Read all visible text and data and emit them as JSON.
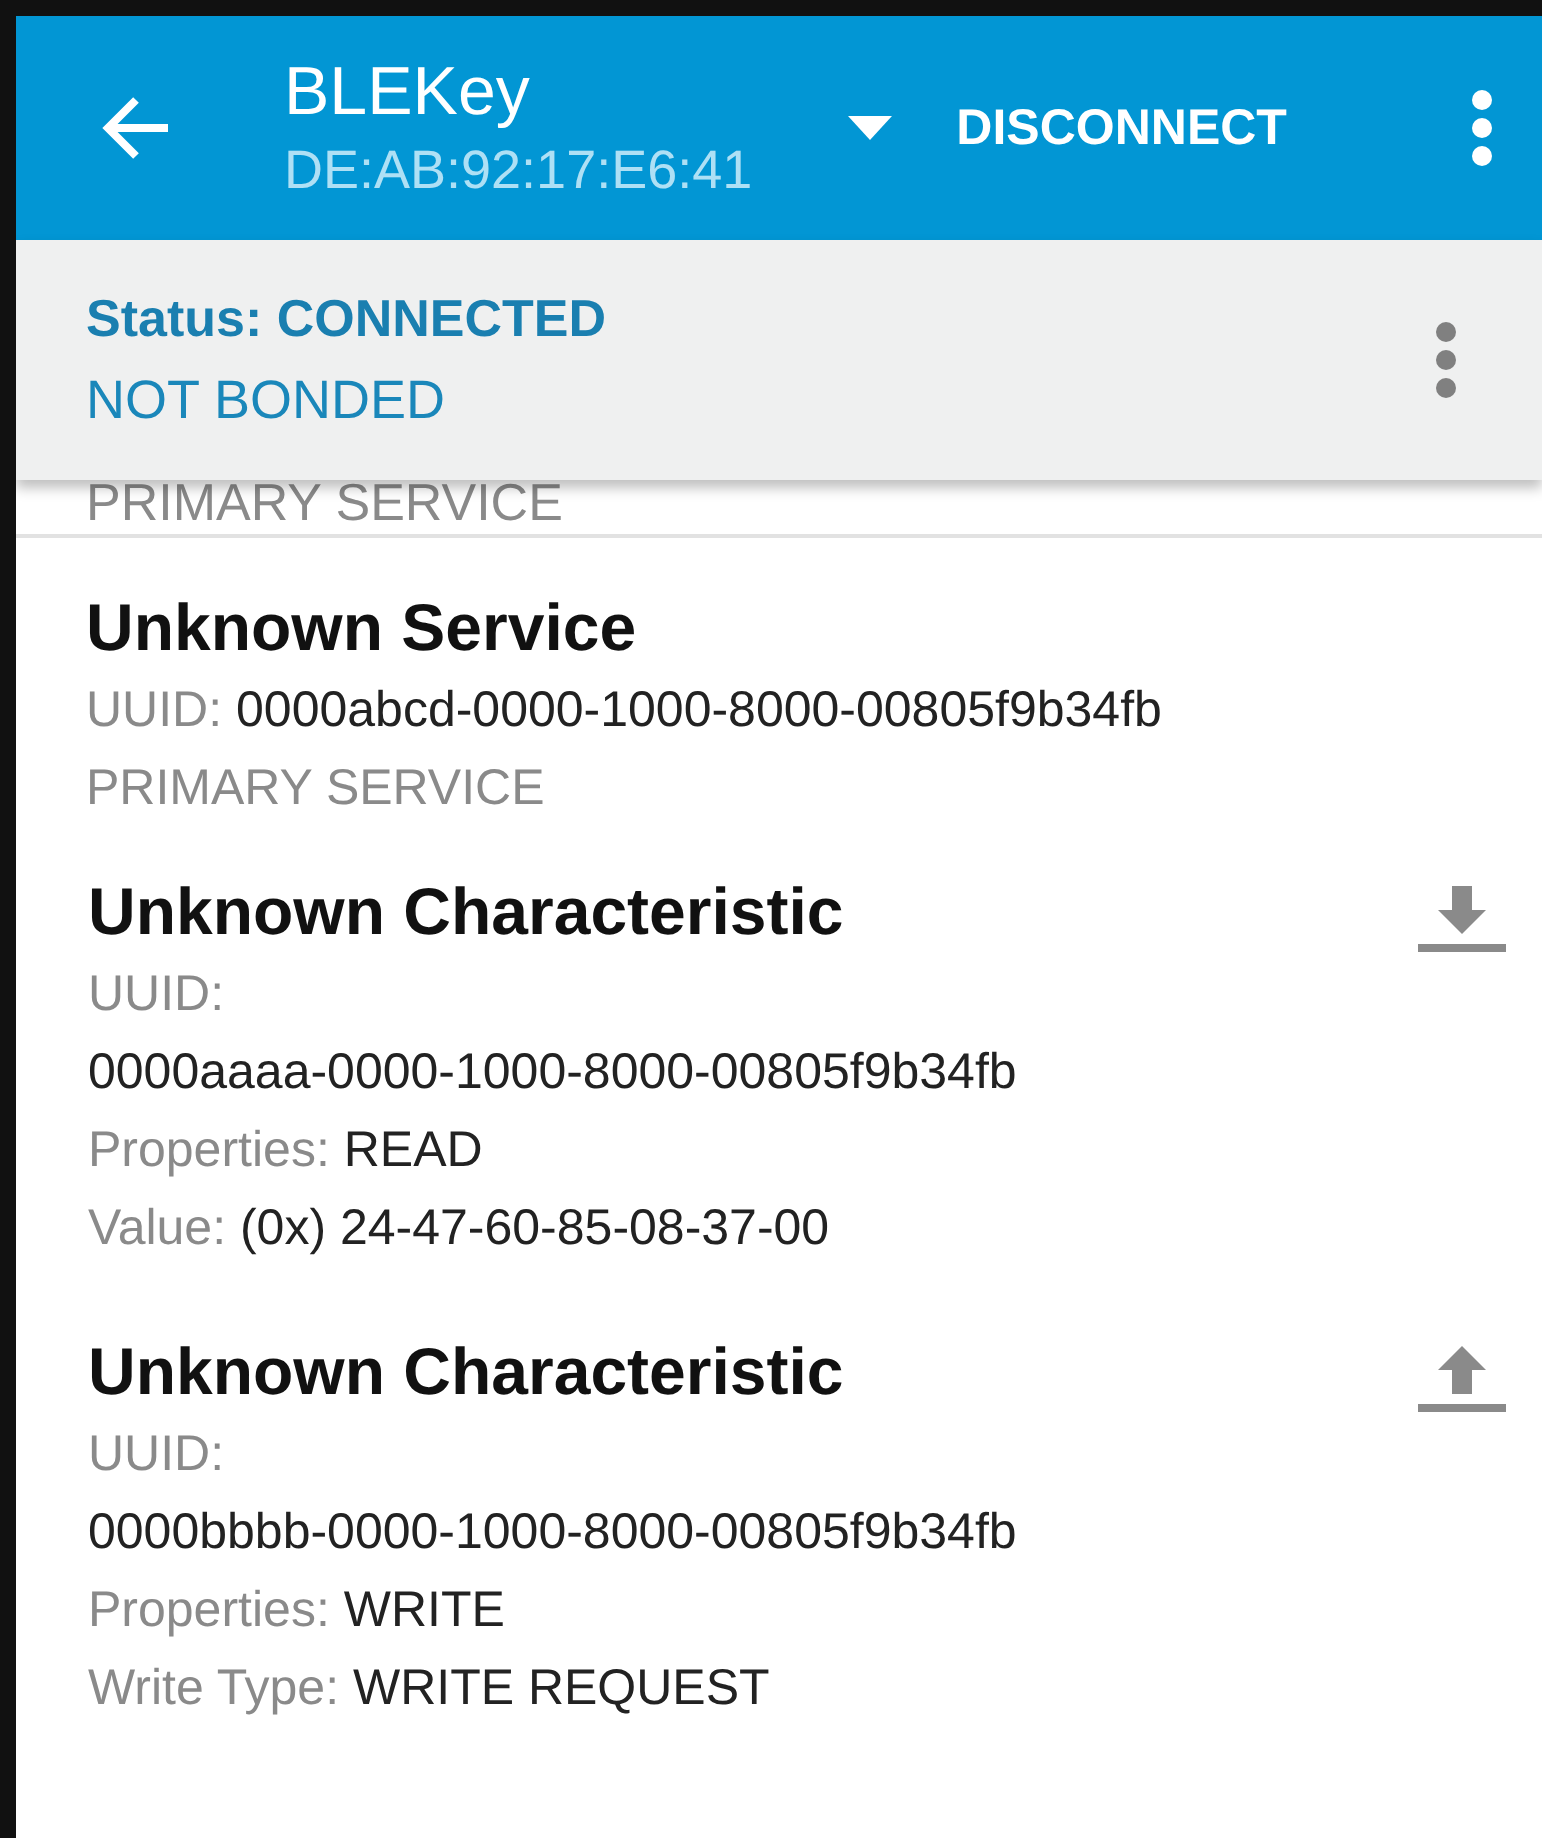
{
  "app_bar": {
    "title": "BLEKey",
    "subtitle": "DE:AB:92:17:E6:41",
    "action": "DISCONNECT"
  },
  "status_panel": {
    "status": "Status: CONNECTED",
    "bond": "NOT BONDED"
  },
  "previous_service": {
    "type": "PRIMARY SERVICE"
  },
  "service": {
    "name": "Unknown Service",
    "uuid_label": "UUID:",
    "uuid": "0000abcd-0000-1000-8000-00805f9b34fb",
    "type": "PRIMARY SERVICE",
    "characteristics": [
      {
        "name": "Unknown Characteristic",
        "kind": "read",
        "uuid_label": "UUID:",
        "uuid": "0000aaaa-0000-1000-8000-00805f9b34fb",
        "fields": [
          {
            "label": "Properties:",
            "value": "READ"
          },
          {
            "label": "Value:",
            "value": "(0x) 24-47-60-85-08-37-00"
          }
        ]
      },
      {
        "name": "Unknown Characteristic",
        "kind": "write",
        "uuid_label": "UUID:",
        "uuid": "0000bbbb-0000-1000-8000-00805f9b34fb",
        "fields": [
          {
            "label": "Properties:",
            "value": "WRITE"
          },
          {
            "label": "Write Type:",
            "value": "WRITE REQUEST"
          }
        ]
      }
    ]
  }
}
